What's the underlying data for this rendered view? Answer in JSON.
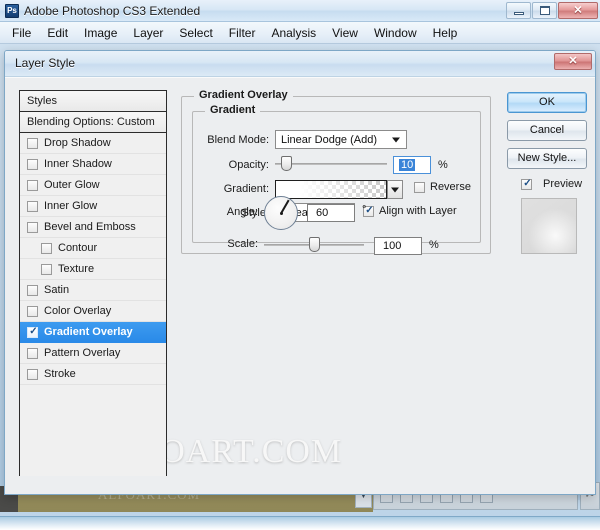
{
  "app": {
    "title": "Adobe Photoshop CS3 Extended",
    "icon_label": "Ps",
    "window_controls": {
      "minimize": "minimize-icon",
      "maximize": "maximize-icon",
      "close": "✕"
    },
    "menu": [
      {
        "label": "File"
      },
      {
        "label": "Edit"
      },
      {
        "label": "Image"
      },
      {
        "label": "Layer"
      },
      {
        "label": "Select"
      },
      {
        "label": "Filter"
      },
      {
        "label": "Analysis"
      },
      {
        "label": "View"
      },
      {
        "label": "Window"
      },
      {
        "label": "Help"
      }
    ]
  },
  "dialog": {
    "title": "Layer Style",
    "close_label": "✕",
    "watermark": "ALFOART.COM",
    "styles_panel": {
      "header": "Styles",
      "blending_options": "Blending Options: Custom",
      "items": [
        {
          "label": "Drop Shadow",
          "checked": false,
          "indent": false,
          "selected": false
        },
        {
          "label": "Inner Shadow",
          "checked": false,
          "indent": false,
          "selected": false
        },
        {
          "label": "Outer Glow",
          "checked": false,
          "indent": false,
          "selected": false
        },
        {
          "label": "Inner Glow",
          "checked": false,
          "indent": false,
          "selected": false
        },
        {
          "label": "Bevel and Emboss",
          "checked": false,
          "indent": false,
          "selected": false
        },
        {
          "label": "Contour",
          "checked": false,
          "indent": true,
          "selected": false
        },
        {
          "label": "Texture",
          "checked": false,
          "indent": true,
          "selected": false
        },
        {
          "label": "Satin",
          "checked": false,
          "indent": false,
          "selected": false
        },
        {
          "label": "Color Overlay",
          "checked": false,
          "indent": false,
          "selected": false
        },
        {
          "label": "Gradient Overlay",
          "checked": true,
          "indent": false,
          "selected": true
        },
        {
          "label": "Pattern Overlay",
          "checked": false,
          "indent": false,
          "selected": false
        },
        {
          "label": "Stroke",
          "checked": false,
          "indent": false,
          "selected": false
        }
      ]
    },
    "gradient_overlay": {
      "section_title": "Gradient Overlay",
      "group_title": "Gradient",
      "blend_mode": {
        "label": "Blend Mode:",
        "value": "Linear Dodge (Add)"
      },
      "opacity": {
        "label": "Opacity:",
        "value": "10",
        "unit": "%",
        "slider_percent": 10
      },
      "gradient": {
        "label": "Gradient:",
        "swatch": "white-to-transparent"
      },
      "reverse": {
        "label": "Reverse",
        "checked": false
      },
      "style": {
        "label": "Style:",
        "value": "Linear"
      },
      "align_with_layer": {
        "label": "Align with Layer",
        "checked": true
      },
      "angle": {
        "label": "Angle:",
        "value": "60",
        "unit": "°",
        "degrees": 60
      },
      "scale": {
        "label": "Scale:",
        "value": "100",
        "unit": "%",
        "slider_percent": 50
      }
    },
    "buttons": {
      "ok": "OK",
      "cancel": "Cancel",
      "new_style": "New Style...",
      "preview": {
        "label": "Preview",
        "checked": true
      }
    }
  },
  "document_window": {
    "watermark": "ALFOART.COM",
    "scroll_arrow": "▼",
    "tool_glyph": "✂"
  },
  "colors": {
    "accent": "#2a8ae8",
    "selection": "#3a84d8",
    "dialog_bg": "#eceef0",
    "titlebar_close": "#cd7676",
    "desktop": "#bdd4e8",
    "document": "#8f8757"
  }
}
